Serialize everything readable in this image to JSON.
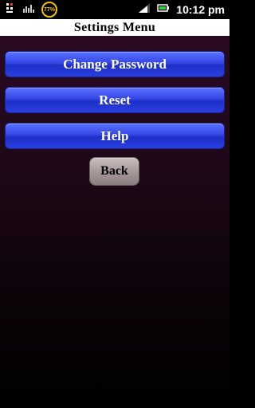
{
  "status_bar": {
    "battery_percent": "77%",
    "time": "10:12 pm",
    "icons": [
      "usb-debug-icon",
      "signal-bars-icon",
      "battery-percent-icon",
      "cell-signal-icon",
      "battery-icon"
    ]
  },
  "title": "Settings Menu",
  "buttons": {
    "change_password": "Change Password",
    "reset": "Reset",
    "help": "Help",
    "back": "Back"
  },
  "colors": {
    "button_blue": "#3447e6",
    "back_gray": "#a89a9a",
    "background_top": "#2a0a22",
    "battery_yellow": "#f2c200"
  }
}
